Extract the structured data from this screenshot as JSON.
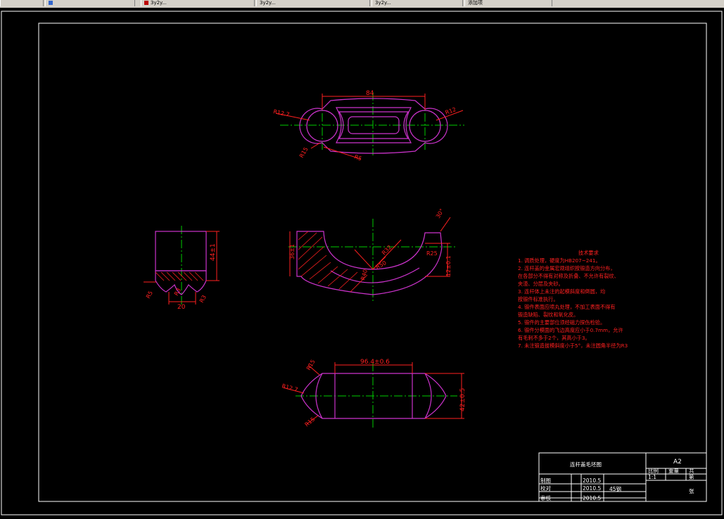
{
  "app": {
    "tabs": [
      {
        "label": ""
      },
      {
        "label": "3y2y..."
      },
      {
        "label": "3y2y..."
      },
      {
        "label": "3y2y..."
      },
      {
        "label": "添加项"
      }
    ]
  },
  "colors": {
    "background": "#000000",
    "outline": "#cc33cc",
    "dimension": "#ff2020",
    "centerline": "#00cc00",
    "frame": "#ffffff"
  },
  "top_view": {
    "dim_width": "84",
    "r_left": "R12.7",
    "r_right": "R12",
    "r_a": "R15",
    "r_b": "R5"
  },
  "side_view": {
    "dim_height": "44±1",
    "r1": "R5",
    "r2": "R3",
    "r3": "R3",
    "dim_20": "20"
  },
  "front_view": {
    "dim_36": "36±1",
    "r40": "R40",
    "r32": "R32",
    "r50": "R50",
    "r25": "R25",
    "dim_12": "12±0.1",
    "angle": "30°"
  },
  "bottom_view": {
    "dim_96": "96.4±0.6",
    "dim_42": "42±0.5",
    "r_a": "R12.7",
    "r_b": "R15",
    "r_c": "R15"
  },
  "tech_req": {
    "title": "技术要求",
    "lines": [
      "1. 调质处理，硬度为HB207~241。",
      "2. 连杆盖的金属宏观组织按锻造方向分布，",
      "   在各部分不得有对称及折叠、不允许有裂纹、",
      "   夹渣、分层及夹砂。",
      "3. 连杆体上未注的起模斜度和倒圆，均",
      "   按锻件标准执行。",
      "4. 锻件表面应喷丸处理，不加工表面不得有",
      "   锻造缺陷、裂纹和氧化皮。",
      "5. 锻件的主要部位须经磁力探伤检验。",
      "6. 锻件分模面的飞边高度应小于0.7mm，允许",
      "   有毛刺不多于2个，其高小于3。",
      "7. 未注锻造拔模斜度小于5°，未注圆角半径为R3"
    ]
  },
  "title_block": {
    "part_name": "连杆盖毛坯图",
    "sheet_size": "A2",
    "scale_label": "比例",
    "scale": "1:1",
    "weight_label": "重量",
    "qty_label": "共",
    "sheet_label": "第",
    "sheet_unit": "张",
    "material": "45钢",
    "rows": [
      {
        "role": "制图",
        "date": "2010.5"
      },
      {
        "role": "校对",
        "date": "2010.5"
      },
      {
        "role": "审核",
        "date": "2010.5"
      }
    ]
  }
}
